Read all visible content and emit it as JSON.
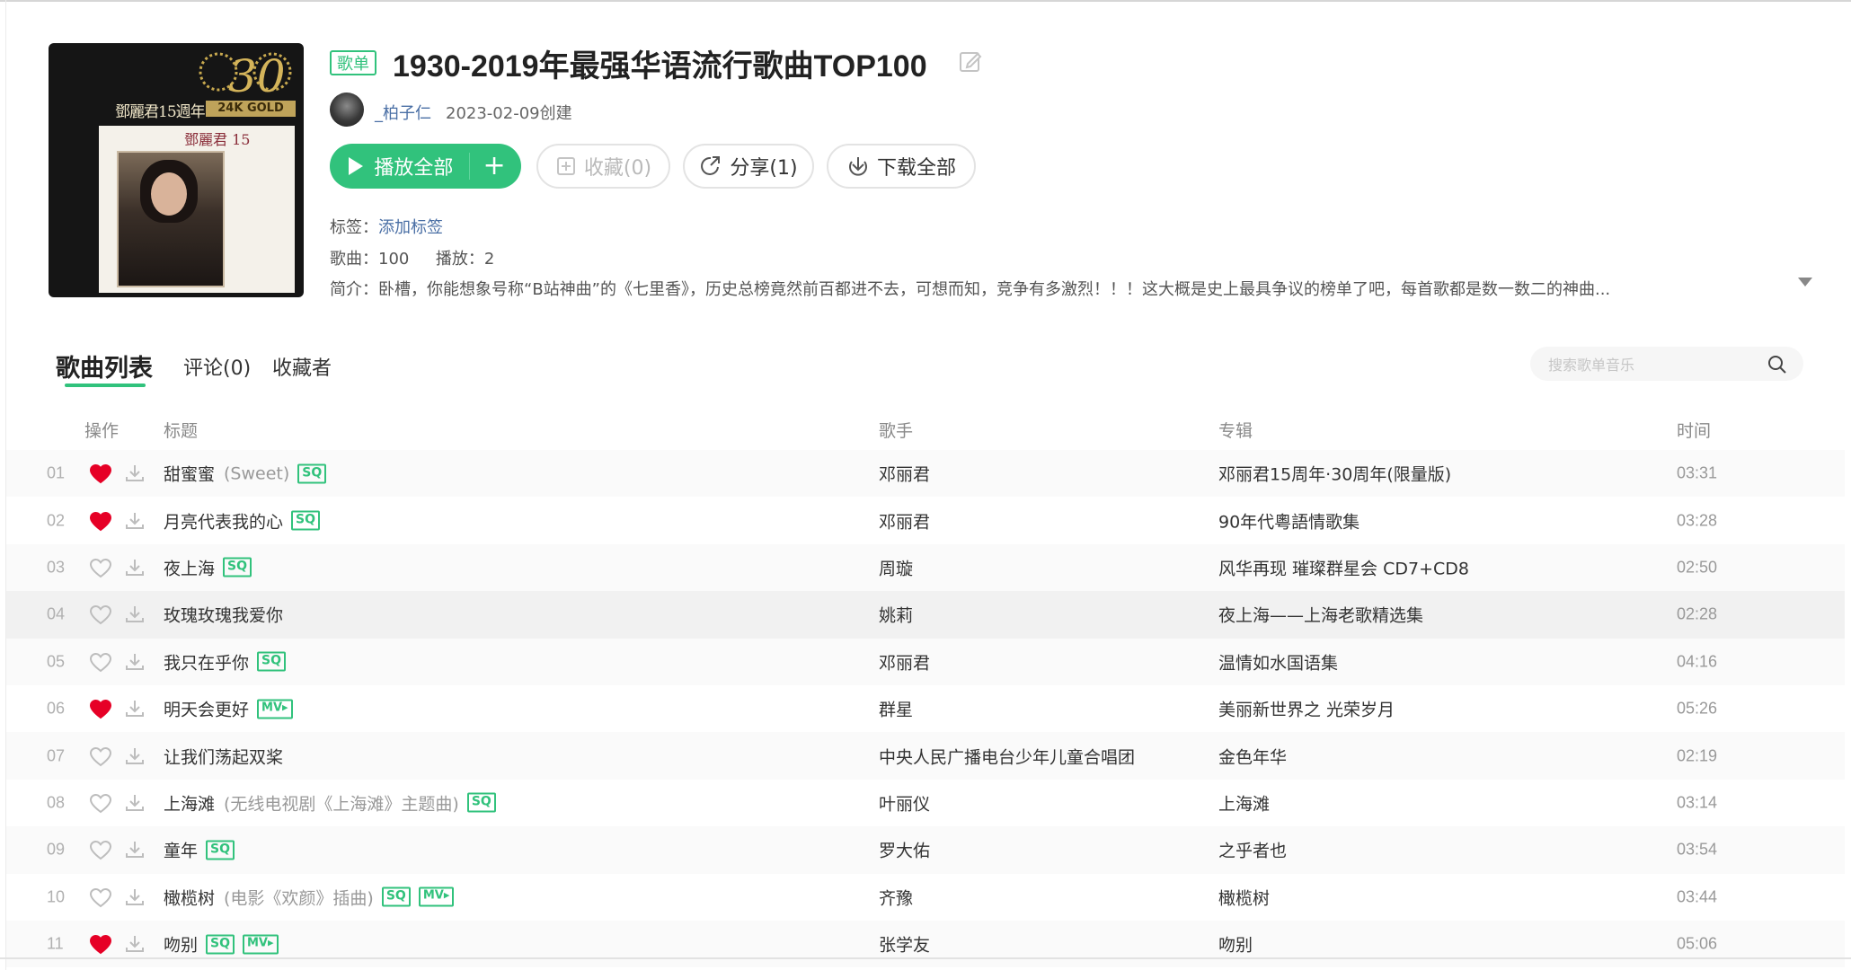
{
  "playlist": {
    "type_badge": "歌单",
    "title": "1930-2019年最强华语流行歌曲TOP100",
    "creator": "_柏子仁",
    "created": "2023-02-09创建",
    "cover": {
      "text_top": "鄧麗君15週年",
      "text_gold": "24K GOLD",
      "text_name": "鄧麗君 15",
      "text_anniv": "30"
    }
  },
  "actions": {
    "play_all": "播放全部",
    "collect": "收藏(0)",
    "share": "分享(1)",
    "download_all": "下载全部"
  },
  "meta": {
    "tags_label": "标签：",
    "tags_add": "添加标签",
    "songs_label": "歌曲：",
    "songs_count": "100",
    "plays_label": "播放：",
    "plays_count": "2",
    "desc_label": "简介：",
    "desc": "卧槽，你能想象号称“B站神曲”的《七里香》，历史总榜竟然前百都进不去，可想而知，竞争有多激烈！！！这大概是史上最具争议的榜单了吧，每首歌都是数一数二的神曲..."
  },
  "tabs": {
    "songs": "歌曲列表",
    "comments": "评论(0)",
    "collectors": "收藏者"
  },
  "search": {
    "placeholder": "搜索歌单音乐"
  },
  "columns": {
    "ops": "操作",
    "title": "标题",
    "artist": "歌手",
    "album": "专辑",
    "time": "时间"
  },
  "colors": {
    "accent": "#31c27c",
    "liked": "#e60026",
    "link": "#4a6fa5"
  },
  "songs": [
    {
      "num": "01",
      "liked": true,
      "title": "甜蜜蜜",
      "sub": "(Sweet)",
      "sq": true,
      "mv": false,
      "artist": "邓丽君",
      "album": "邓丽君15周年·30周年(限量版)",
      "time": "03:31"
    },
    {
      "num": "02",
      "liked": true,
      "title": "月亮代表我的心",
      "sub": "",
      "sq": true,
      "mv": false,
      "artist": "邓丽君",
      "album": "90年代粵語情歌集",
      "time": "03:28"
    },
    {
      "num": "03",
      "liked": false,
      "title": "夜上海",
      "sub": "",
      "sq": true,
      "mv": false,
      "artist": "周璇",
      "album": "风华再现 璀璨群星会 CD7+CD8",
      "time": "02:50"
    },
    {
      "num": "04",
      "liked": false,
      "title": "玫瑰玫瑰我爱你",
      "sub": "",
      "sq": false,
      "mv": false,
      "artist": "姚莉",
      "album": "夜上海——上海老歌精选集",
      "time": "02:28"
    },
    {
      "num": "05",
      "liked": false,
      "title": "我只在乎你",
      "sub": "",
      "sq": true,
      "mv": false,
      "artist": "邓丽君",
      "album": "温情如水国语集",
      "time": "04:16"
    },
    {
      "num": "06",
      "liked": true,
      "title": "明天会更好",
      "sub": "",
      "sq": false,
      "mv": true,
      "artist": "群星",
      "album": "美丽新世界之 光荣岁月",
      "time": "05:26"
    },
    {
      "num": "07",
      "liked": false,
      "title": "让我们荡起双桨",
      "sub": "",
      "sq": false,
      "mv": false,
      "artist": "中央人民广播电台少年儿童合唱团",
      "album": "金色年华",
      "time": "02:19"
    },
    {
      "num": "08",
      "liked": false,
      "title": "上海滩",
      "sub": "(无线电视剧《上海滩》主题曲)",
      "sq": true,
      "mv": false,
      "artist": "叶丽仪",
      "album": "上海滩",
      "time": "03:14"
    },
    {
      "num": "09",
      "liked": false,
      "title": "童年",
      "sub": "",
      "sq": true,
      "mv": false,
      "artist": "罗大佑",
      "album": "之乎者也",
      "time": "03:54"
    },
    {
      "num": "10",
      "liked": false,
      "title": "橄榄树",
      "sub": "(电影《欢颜》插曲)",
      "sq": true,
      "mv": true,
      "artist": "齐豫",
      "album": "橄榄树",
      "time": "03:44"
    },
    {
      "num": "11",
      "liked": true,
      "title": "吻别",
      "sub": "",
      "sq": true,
      "mv": true,
      "artist": "张学友",
      "album": "吻别",
      "time": "05:06"
    }
  ]
}
